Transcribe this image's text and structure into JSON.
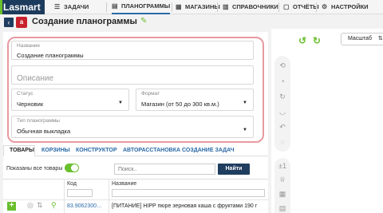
{
  "app": {
    "logo_text": "Lasmart"
  },
  "nav": {
    "items": [
      {
        "label": "ЗАДАЧИ",
        "icon": "tasks-icon"
      },
      {
        "label": "ПЛАНОГРАММЫ",
        "icon": "planogram-icon",
        "active": true
      },
      {
        "label": "МАГАЗИНЫ",
        "icon": "store-icon"
      },
      {
        "label": "СПРАВОЧНИКИ",
        "icon": "directory-icon"
      },
      {
        "label": "ОТЧЁТЫ",
        "icon": "reports-icon"
      },
      {
        "label": "НАСТРОЙКИ",
        "icon": "settings-icon"
      }
    ]
  },
  "header": {
    "title": "Создание планограммы",
    "badge": "a"
  },
  "form": {
    "name": {
      "label": "Название",
      "value": "Создание планограммы"
    },
    "description": {
      "placeholder": "Описание"
    },
    "status": {
      "label": "Статус",
      "value": "Черновик"
    },
    "format": {
      "label": "Формат",
      "value": "Магазин (от 50 до 300 кв.м.)"
    },
    "type": {
      "label": "Тип планограммы",
      "value": "Обычная выкладка"
    }
  },
  "tabs": [
    "ТОВАРЫ",
    "КОРЗИНЫ",
    "КОНСТРУКТОР",
    "АВТОРАССТАНОВКА",
    "СОЗДАНИЕ ЗАДАЧ"
  ],
  "products": {
    "show_all_label": "Показаны все товары",
    "show_all_on": true,
    "search_placeholder": "Поиск..",
    "find_label": "Найти",
    "columns": {
      "code": "Код",
      "name": "Название"
    },
    "rows": [
      {
        "code": "83.9062300…",
        "name": "[ПИТАНИЕ] HIPP пюре зерновая каша с фруктами 190 г"
      }
    ]
  },
  "canvas": {
    "scale_label": "Масштаб",
    "scale_toggle": "⇅",
    "plus_minus": "±1"
  },
  "colors": {
    "accent_green": "#6abf2e",
    "navy": "#1f3d5e",
    "link_blue": "#2b6aa8",
    "highlight": "#e79aa0"
  }
}
